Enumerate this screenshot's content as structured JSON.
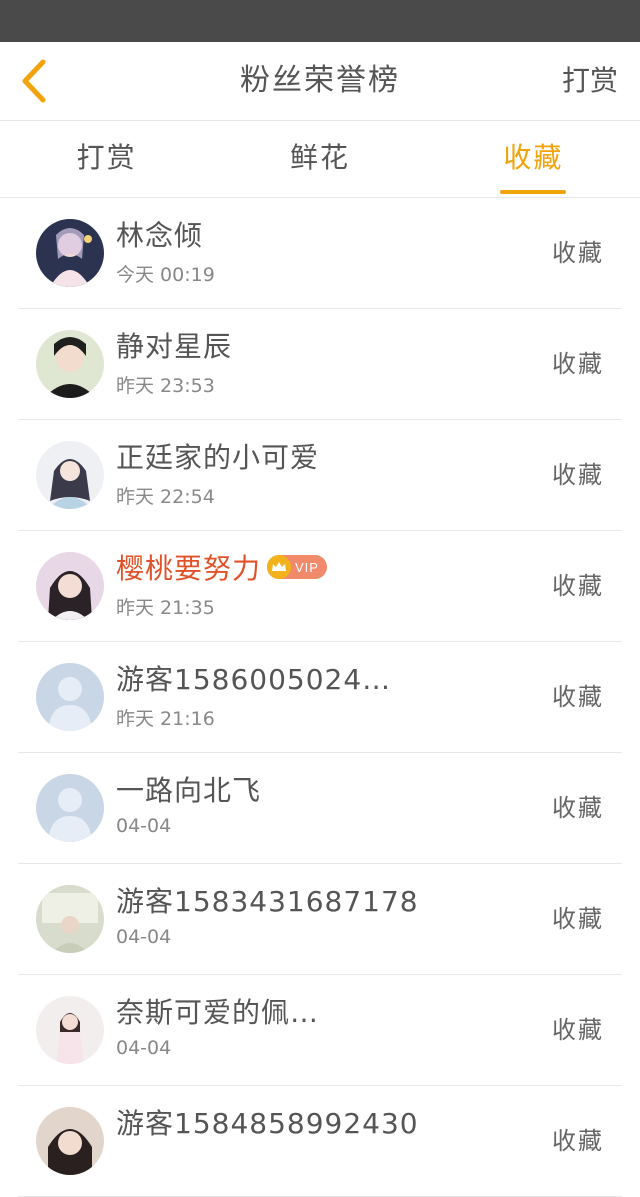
{
  "header": {
    "title": "粉丝荣誉榜",
    "action_label": "打赏"
  },
  "tabs": [
    {
      "label": "打赏",
      "active": false
    },
    {
      "label": "鲜花",
      "active": false
    },
    {
      "label": "收藏",
      "active": true
    }
  ],
  "colors": {
    "accent": "#f0a30a",
    "vip_name": "#e0522a",
    "status_bar": "#4a4a4a"
  },
  "rows": [
    {
      "name": "林念倾",
      "time": "今天 00:19",
      "action": "收藏",
      "vip": false,
      "vip_label": ""
    },
    {
      "name": "静对星辰",
      "time": "昨天 23:53",
      "action": "收藏",
      "vip": false,
      "vip_label": ""
    },
    {
      "name": "正廷家的小可爱",
      "time": "昨天 22:54",
      "action": "收藏",
      "vip": false,
      "vip_label": ""
    },
    {
      "name": "樱桃要努力",
      "time": "昨天 21:35",
      "action": "收藏",
      "vip": true,
      "vip_label": "VIP"
    },
    {
      "name": "游客1586005024…",
      "time": "昨天 21:16",
      "action": "收藏",
      "vip": false,
      "vip_label": ""
    },
    {
      "name": "一路向北飞",
      "time": "04-04",
      "action": "收藏",
      "vip": false,
      "vip_label": ""
    },
    {
      "name": "游客1583431687178",
      "time": "04-04",
      "action": "收藏",
      "vip": false,
      "vip_label": ""
    },
    {
      "name": "奈斯可爱的佩…",
      "time": "04-04",
      "action": "收藏",
      "vip": false,
      "vip_label": ""
    },
    {
      "name": "游客1584858992430",
      "time": "",
      "action": "收藏",
      "vip": false,
      "vip_label": ""
    }
  ]
}
